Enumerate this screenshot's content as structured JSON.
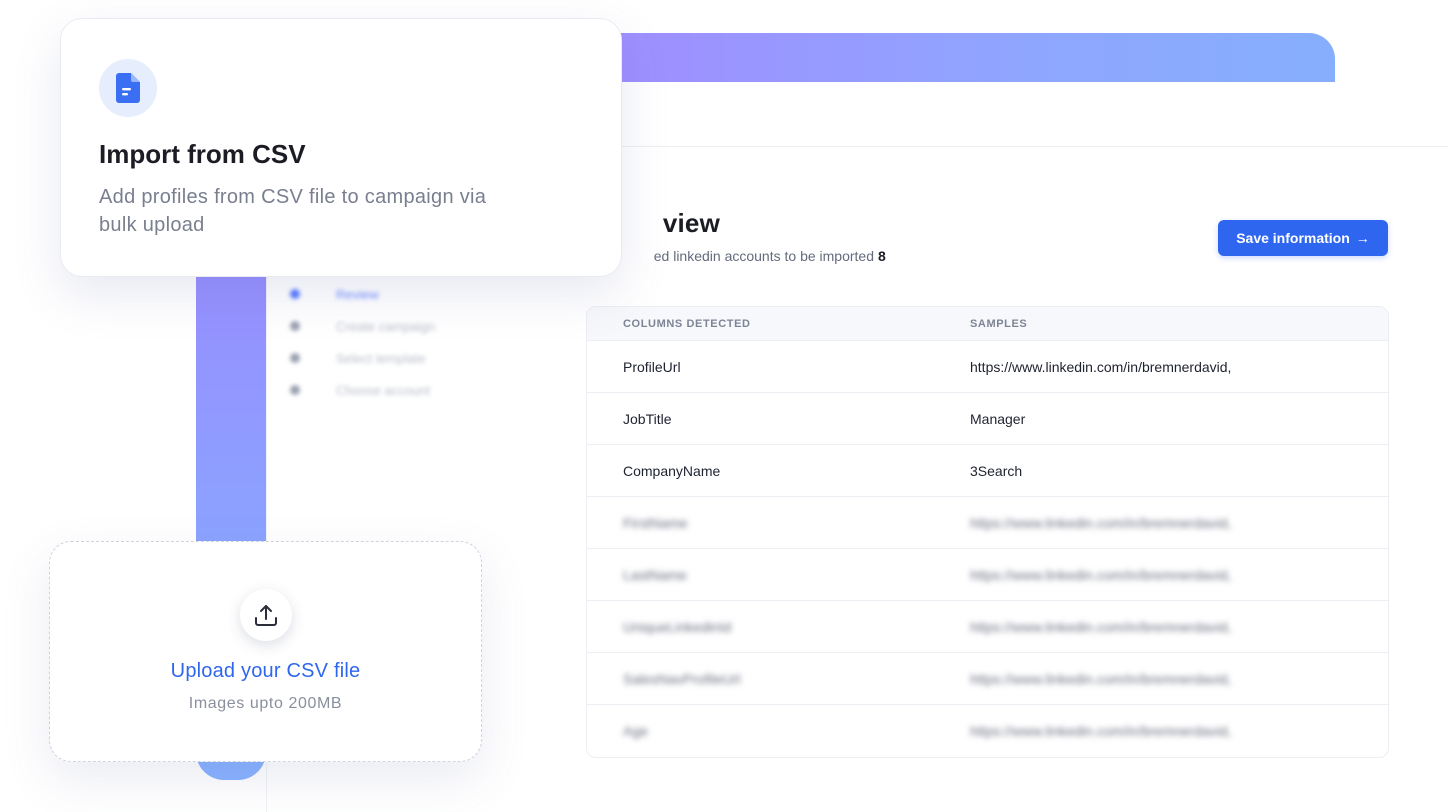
{
  "import_card": {
    "icon": "document-icon",
    "title": "Import from CSV",
    "description": "Add profiles from CSV file to campaign via bulk upload"
  },
  "steps": [
    {
      "label": "Review",
      "active": true
    },
    {
      "label": "Create campaign",
      "active": false
    },
    {
      "label": "Select template",
      "active": false
    },
    {
      "label": "Choose account",
      "active": false
    }
  ],
  "review": {
    "title": "view",
    "subtitle": "ed linkedin accounts to be imported",
    "count": "8",
    "save_button": "Save information",
    "save_icon": "arrow-right-icon"
  },
  "table": {
    "headers": [
      "COLUMNS DETECTED",
      "SAMPLES"
    ],
    "rows": [
      {
        "column": "ProfileUrl",
        "sample": "https://www.linkedin.com/in/bremnerdavid,",
        "blurred": false
      },
      {
        "column": "JobTitle",
        "sample": "Manager",
        "blurred": false
      },
      {
        "column": "CompanyName",
        "sample": "3Search",
        "blurred": false
      },
      {
        "column": "FirstName",
        "sample": "https://www.linkedin.com/in/bremnerdavid,",
        "blurred": true
      },
      {
        "column": "LastName",
        "sample": "https://www.linkedin.com/in/bremnerdavid,",
        "blurred": true
      },
      {
        "column": "UniqueLinkedinId",
        "sample": "https://www.linkedin.com/in/bremnerdavid,",
        "blurred": true
      },
      {
        "column": "SalesNavProfileUrl",
        "sample": "https://www.linkedin.com/in/bremnerdavid,",
        "blurred": true
      },
      {
        "column": "Age",
        "sample": "https://www.linkedin.com/in/bremnerdavid,",
        "blurred": true
      }
    ]
  },
  "upload": {
    "icon": "upload-icon",
    "title": "Upload your CSV file",
    "subtitle": "Images upto 200MB"
  },
  "colors": {
    "accent": "#2f66f0",
    "banner_start": "#a18bff",
    "banner_end": "#86aefd"
  }
}
